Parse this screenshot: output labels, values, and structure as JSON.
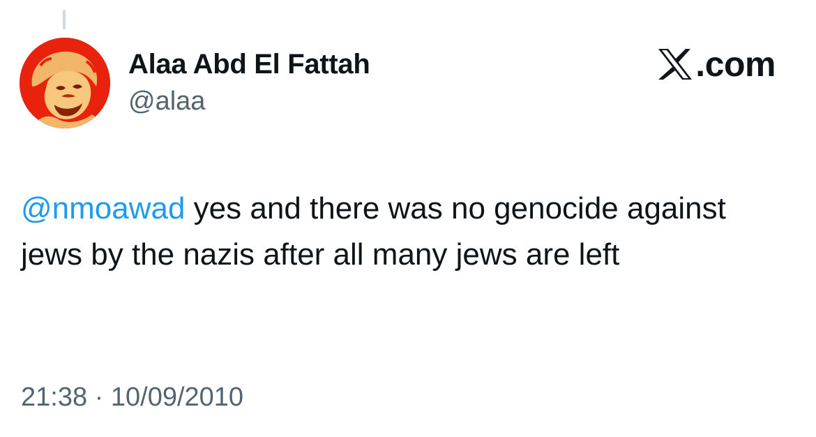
{
  "author": {
    "display_name": "Alaa Abd El Fattah",
    "handle": "@alaa",
    "avatar_icon": "portrait-avatar-red"
  },
  "brand": {
    "icon": "x-logo-icon",
    "label": ".com"
  },
  "tweet": {
    "mention": "@nmoawad",
    "text": " yes and there was no genocide against jews by the nazis after all many jews are left"
  },
  "meta": {
    "time": "21:38",
    "separator": " · ",
    "date": "10/09/2010"
  },
  "colors": {
    "mention": "#1d9bf0",
    "secondary_text": "#536471",
    "avatar_background": "#e8220c"
  }
}
